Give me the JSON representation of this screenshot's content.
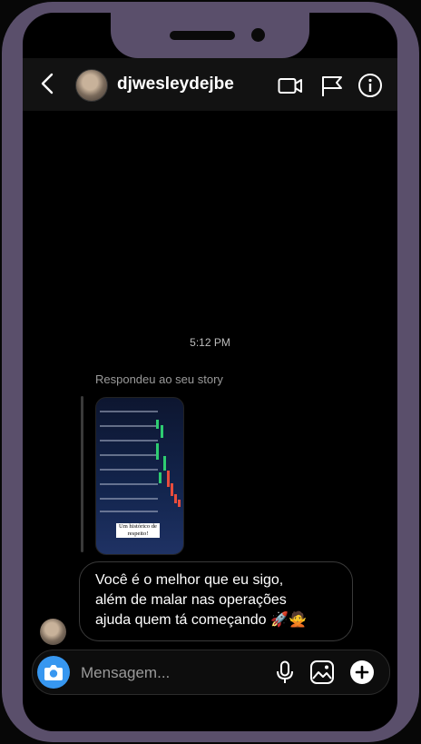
{
  "header": {
    "username": "djwesleydejbe"
  },
  "conversation": {
    "timestamp": "5:12 PM",
    "story_reply_label": "Respondeu ao seu story",
    "story_caption": "Um histórico de\nrespeito!",
    "message": "Você é o melhor que eu sigo,\nalém de malar nas operações\najuda quem tá começando 🚀🙅"
  },
  "composer": {
    "placeholder": "Mensagem..."
  },
  "colors": {
    "frame": "#5a4f6b",
    "accent": "#3797f0",
    "background": "#000000"
  },
  "icons": [
    "back-icon",
    "video-call-icon",
    "flag-icon",
    "info-icon",
    "camera-icon",
    "microphone-icon",
    "gallery-icon",
    "add-icon"
  ]
}
